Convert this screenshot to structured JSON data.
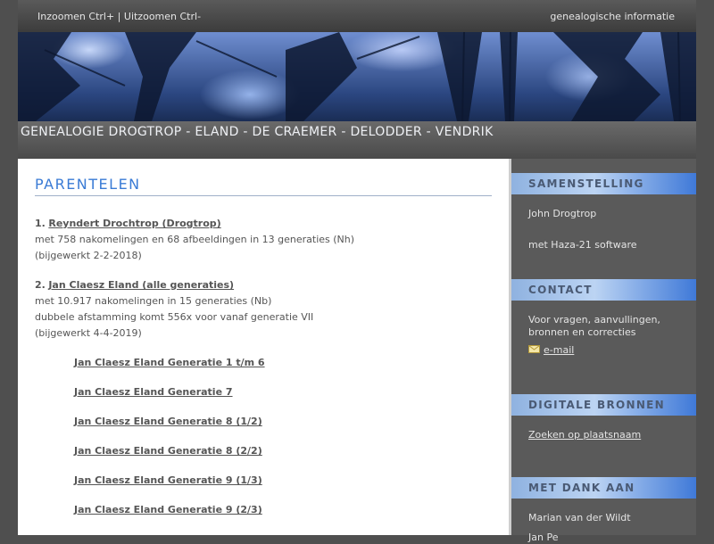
{
  "topbar": {
    "zoom_text": "Inzoomen Ctrl+ | Uitzoomen Ctrl-",
    "right_link": "genealogische informatie"
  },
  "site_title": "GENEALOGIE DROGTROP - ELAND - DE CRAEMER - DELODDER - VENDRIK",
  "main": {
    "page_title": "PARENTELEN",
    "entries": [
      {
        "number": "1.",
        "link": "Reyndert Drochtrop (Drogtrop)",
        "lines": [
          "met 758 nakomelingen en 68 afbeeldingen in 13 generaties (Nh)",
          "(bijgewerkt 2-2-2018)"
        ]
      },
      {
        "number": "2.",
        "link": "Jan Claesz Eland (alle generaties)",
        "lines": [
          "met 10.917 nakomelingen in 15 generaties (Nb)",
          "dubbele afstamming komt 556x voor vanaf generatie VII",
          "(bijgewerkt 4-4-2019)"
        ]
      }
    ],
    "sublinks": [
      "Jan Claesz Eland Generatie 1 t/m 6",
      "Jan Claesz Eland Generatie 7",
      "Jan Claesz Eland Generatie 8 (1/2)",
      "Jan Claesz Eland Generatie 8 (2/2)",
      "Jan Claesz Eland Generatie 9 (1/3)",
      "Jan Claesz Eland Generatie 9 (2/3)"
    ]
  },
  "sidebar": {
    "samenstelling": {
      "title": "SAMENSTELLING",
      "author": "John Drogtrop",
      "software": "met Haza-21 software"
    },
    "contact": {
      "title": "CONTACT",
      "text": "Voor vragen, aanvullingen, bronnen en correcties",
      "email_label": "e-mail",
      "icon": "envelope-icon"
    },
    "bronnen": {
      "title": "DIGITALE BRONNEN",
      "link": "Zoeken op plaatsnaam"
    },
    "dank": {
      "title": "MET DANK AAN",
      "names": [
        "Marian van der Wildt",
        "Jan Pe"
      ]
    }
  },
  "colors": {
    "accent": "#3a7bd5",
    "background": "#4f4f4f",
    "sidebar": "#5a5a5a"
  }
}
